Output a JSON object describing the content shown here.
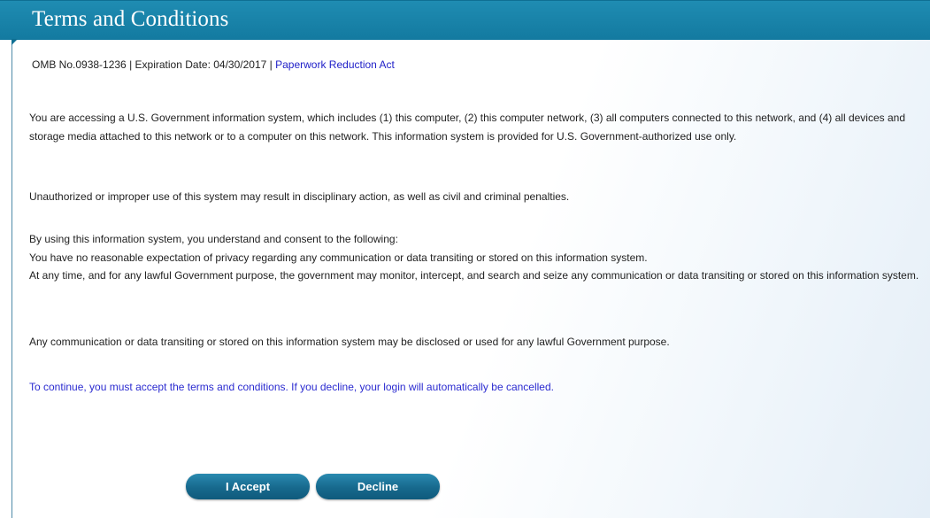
{
  "header": {
    "title": "Terms and Conditions"
  },
  "meta": {
    "omb": "OMB No.0938-1236",
    "separator": " | ",
    "expiration": "Expiration Date: 04/30/2017",
    "link_text": "Paperwork Reduction Act"
  },
  "content": {
    "p1": "You are accessing a U.S. Government information system, which includes (1) this computer, (2) this computer network, (3) all computers connected to this network, and (4) all devices and storage media attached to this network or to a computer on this network. This information system is provided for U.S. Government-authorized use only.",
    "p2": "Unauthorized or improper use of this system may result in disciplinary action, as well as civil and criminal penalties.",
    "p3_line1": "By using this information system, you understand and consent to the following:",
    "p3_line2": "You have no reasonable expectation of privacy regarding any communication or data transiting or stored on this information system.",
    "p3_line3": "At any time, and for any lawful Government purpose, the government may monitor, intercept, and search and seize any communication or data transiting or stored on this information system.",
    "p4": "Any communication or data transiting or stored on this information system may be disclosed or used for any lawful Government purpose.",
    "p5": "To continue, you must accept the terms and conditions. If you decline, your login will automatically be cancelled."
  },
  "buttons": {
    "accept": "I Accept",
    "decline": "Decline"
  },
  "colors": {
    "header": "#137aa0",
    "link": "#2020c8",
    "button": "#17698d"
  }
}
